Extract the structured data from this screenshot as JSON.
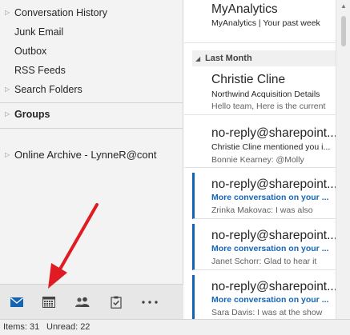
{
  "folders": [
    {
      "label": "Conversation History",
      "has_caret": true
    },
    {
      "label": "Junk Email",
      "has_caret": false
    },
    {
      "label": "Outbox",
      "has_caret": false
    },
    {
      "label": "RSS Feeds",
      "has_caret": false
    },
    {
      "label": "Search Folders",
      "has_caret": true
    }
  ],
  "groups_label": "Groups",
  "online_archive_label": "Online Archive - LynneR@cont",
  "modules": [
    {
      "name": "mail-icon",
      "active": true
    },
    {
      "name": "calendar-icon",
      "active": false
    },
    {
      "name": "people-icon",
      "active": false
    },
    {
      "name": "tasks-icon",
      "active": false
    },
    {
      "name": "more-icon",
      "active": false
    }
  ],
  "messages_top": {
    "sender": "MyAnalytics",
    "subject": "MyAnalytics | Your past week"
  },
  "group_header": "Last Month",
  "messages": [
    {
      "sender": "Christie Cline",
      "subject": "Northwind Acquisition Details",
      "preview": "Hello team,  Here is the current",
      "unread": false
    },
    {
      "sender": "no-reply@sharepoint...",
      "subject": "Christie Cline mentioned you i...",
      "preview": "Bonnie Kearney: @Molly",
      "unread": false
    },
    {
      "sender": "no-reply@sharepoint...",
      "subject": "More conversation on your ...",
      "preview": "Zrinka Makovac: I was also",
      "unread": true
    },
    {
      "sender": "no-reply@sharepoint...",
      "subject": "More conversation on your ...",
      "preview": "Janet Schorr: Glad to hear it",
      "unread": true
    },
    {
      "sender": "no-reply@sharepoint...",
      "subject": "More conversation on your ...",
      "preview": "Sara Davis: I was at the show",
      "unread": true
    }
  ],
  "status": {
    "items": "Items: 31",
    "unread": "Unread: 22"
  },
  "colors": {
    "accent": "#1464b4",
    "arrow": "#e01b24"
  }
}
